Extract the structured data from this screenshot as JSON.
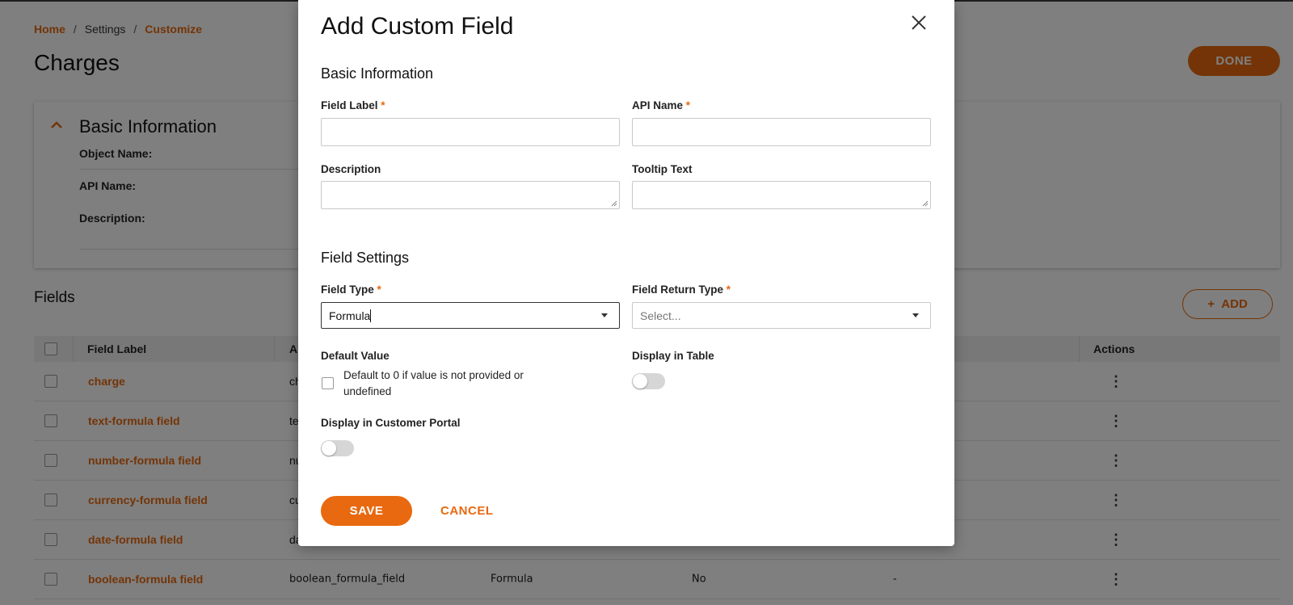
{
  "breadcrumb": {
    "home": "Home",
    "settings": "Settings",
    "customize": "Customize",
    "separator": "/"
  },
  "page": {
    "title": "Charges",
    "done_label": "DONE"
  },
  "basic_info_card": {
    "title": "Basic Information",
    "object_name_label": "Object Name:",
    "api_name_label": "API Name:",
    "description_label": "Description:"
  },
  "fields_section": {
    "title": "Fields",
    "add_label": "ADD",
    "columns": [
      "Field Label",
      "A",
      "Actions"
    ],
    "rows": [
      {
        "label": "charge",
        "api": "ch"
      },
      {
        "label": "text-formula field",
        "api": "te"
      },
      {
        "label": "number-formula field",
        "api": "nu"
      },
      {
        "label": "currency-formula field",
        "api": "cu"
      },
      {
        "label": "date-formula field",
        "api": "da"
      },
      {
        "label": "boolean-formula field",
        "api": "boolean_formula_field",
        "type": "Formula",
        "required": "No",
        "default": "-"
      }
    ]
  },
  "modal": {
    "title": "Add Custom Field",
    "basic_section_title": "Basic Information",
    "field_label": "Field Label",
    "api_name": "API Name",
    "description": "Description",
    "tooltip_text": "Tooltip Text",
    "settings_section_title": "Field Settings",
    "field_type": "Field Type",
    "field_type_value": "Formula",
    "field_return_type": "Field Return Type",
    "field_return_type_placeholder": "Select...",
    "default_value": "Default Value",
    "default_checkbox_text": "Default to 0 if value is not provided or undefined",
    "display_in_table": "Display in Table",
    "display_in_portal": "Display in Customer Portal",
    "required_mark": "*",
    "save_label": "SAVE",
    "cancel_label": "CANCEL"
  },
  "colors": {
    "accent": "#e8690f",
    "overlay": "rgba(0,0,0,0.5)"
  }
}
